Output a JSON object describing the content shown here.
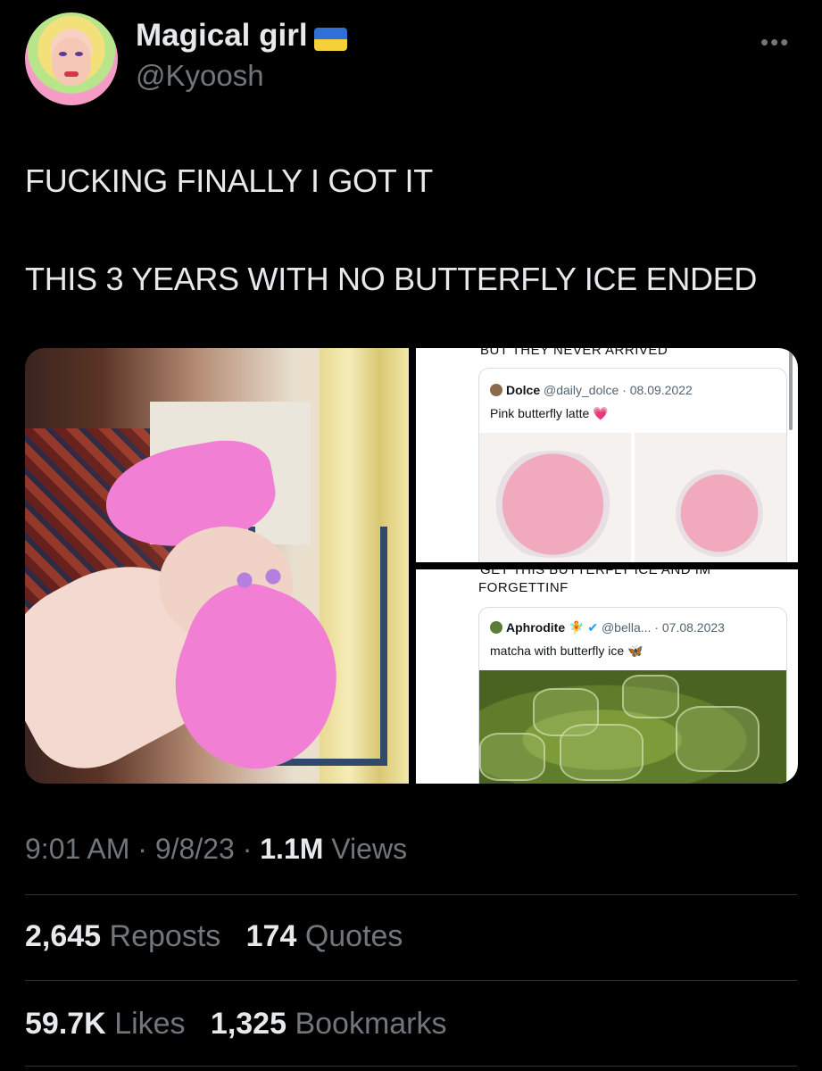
{
  "author": {
    "display_name": "Magical girl",
    "handle": "@Kyoosh",
    "flag_icon": "ukraine-flag-icon"
  },
  "more_glyph": "•••",
  "tweet": {
    "line1": "FUCKING FINALLY I GOT IT",
    "line2": "THIS 3 YEARS WITH NO BUTTERFLY ICE ENDED"
  },
  "media": {
    "top_panel": {
      "cut_text": "BUT THEY NEVER ARRIVED",
      "quote": {
        "name": "Dolce",
        "handle": "@daily_dolce",
        "date": "08.09.2022",
        "text": "Pink butterfly latte",
        "emoji": "💗"
      }
    },
    "bottom_panel": {
      "cut_text": "GET THIS BUTTERFLY ICE AND IM",
      "cut_text2": "FORGETTINF",
      "quote": {
        "name": "Aphrodite",
        "name_emoji": "🧚",
        "handle": "@bella...",
        "date": "07.08.2023",
        "text": "matcha with butterfly ice",
        "emoji": "🦋"
      }
    }
  },
  "stats": {
    "time": "9:01 AM",
    "date": "9/8/23",
    "views_count": "1.1M",
    "views_label": "Views"
  },
  "engagement": {
    "reposts_count": "2,645",
    "reposts_label": "Reposts",
    "quotes_count": "174",
    "quotes_label": "Quotes",
    "likes_count": "59.7K",
    "likes_label": "Likes",
    "bookmarks_count": "1,325",
    "bookmarks_label": "Bookmarks"
  },
  "separator": "·",
  "colors": {
    "background": "#000000",
    "text": "#e7e9ea",
    "secondary": "#71767b",
    "divider": "#2f3336",
    "verified": "#1d9bf0"
  }
}
